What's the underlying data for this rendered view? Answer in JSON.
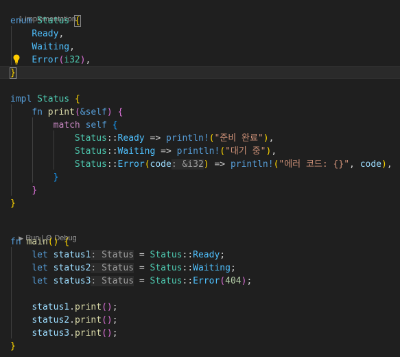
{
  "codelens": {
    "implementations": "1 implementation",
    "run": "Run",
    "separator": " | ",
    "debug": "Debug",
    "run_glyph": "▶",
    "debug_glyph": "⚙"
  },
  "code": {
    "enum_line": {
      "kw": "enum",
      "name": "Status",
      "brace": "{"
    },
    "variants": [
      {
        "name": "Ready",
        "punct": ","
      },
      {
        "name": "Waiting",
        "punct": ","
      },
      {
        "name": "Error",
        "open": "(",
        "type": "i32",
        "close": ")",
        "punct": ","
      }
    ],
    "enum_close": "}",
    "impl_line": {
      "kw": "impl",
      "name": "Status",
      "brace": "{"
    },
    "fn_print": {
      "kw": "fn",
      "name": "print",
      "open": "(",
      "ref": "&",
      "self_kw": "self",
      "close": ")",
      "brace": "{"
    },
    "match_line": {
      "kw": "match",
      "self_kw": "self",
      "brace": "{"
    },
    "arms": [
      {
        "type": "Status",
        "sep": "::",
        "variant": "Ready",
        "arrow": " => ",
        "macro": "println!",
        "open": "(",
        "str": "\"준비 완료\"",
        "close": ")",
        "punct": ","
      },
      {
        "type": "Status",
        "sep": "::",
        "variant": "Waiting",
        "arrow": " => ",
        "macro": "println!",
        "open": "(",
        "str": "\"대기 중\"",
        "close": ")",
        "punct": ","
      },
      {
        "type": "Status",
        "sep": "::",
        "variant": "Error",
        "open1": "(",
        "binding": "code",
        "hint": ": &i32",
        "close1": ")",
        "arrow": " => ",
        "macro": "println!",
        "open": "(",
        "str": "\"에러 코드: {}\"",
        "comma": ", ",
        "arg": "code",
        "close": ")",
        "punct": ","
      }
    ],
    "match_close": "}",
    "fn_close": "}",
    "impl_close": "}",
    "main_line": {
      "kw": "fn",
      "name": "main",
      "parens": "()",
      "brace": "{"
    },
    "lets": [
      {
        "kw": "let",
        "var": "status1",
        "hint": ": Status",
        "eq": " = ",
        "type": "Status",
        "sep": "::",
        "variant": "Ready",
        "end": ";"
      },
      {
        "kw": "let",
        "var": "status2",
        "hint": ": Status",
        "eq": " = ",
        "type": "Status",
        "sep": "::",
        "variant": "Waiting",
        "end": ";"
      },
      {
        "kw": "let",
        "var": "status3",
        "hint": ": Status",
        "eq": " = ",
        "type": "Status",
        "sep": "::",
        "variant": "Error",
        "open": "(",
        "num": "404",
        "close": ")",
        "end": ";"
      }
    ],
    "calls": [
      {
        "var": "status1",
        "dot": ".",
        "method": "print",
        "parens": "()",
        "end": ";"
      },
      {
        "var": "status2",
        "dot": ".",
        "method": "print",
        "parens": "()",
        "end": ";"
      },
      {
        "var": "status3",
        "dot": ".",
        "method": "print",
        "parens": "()",
        "end": ";"
      }
    ],
    "main_close": "}"
  },
  "icons": {
    "lightbulb": "lightbulb-icon"
  },
  "colors": {
    "background": "#1f1f1f",
    "keyword": "#569cd6",
    "control": "#c586c0",
    "type": "#4ec9b0",
    "enum_member": "#4fc1ff",
    "function": "#dcdcaa",
    "string": "#ce9178",
    "number": "#b5cea8",
    "variable": "#9cdcfe",
    "bracket1": "#ffd700",
    "bracket2": "#da70d6",
    "bracket3": "#179fff",
    "lightbulb": "#ffcc00"
  }
}
